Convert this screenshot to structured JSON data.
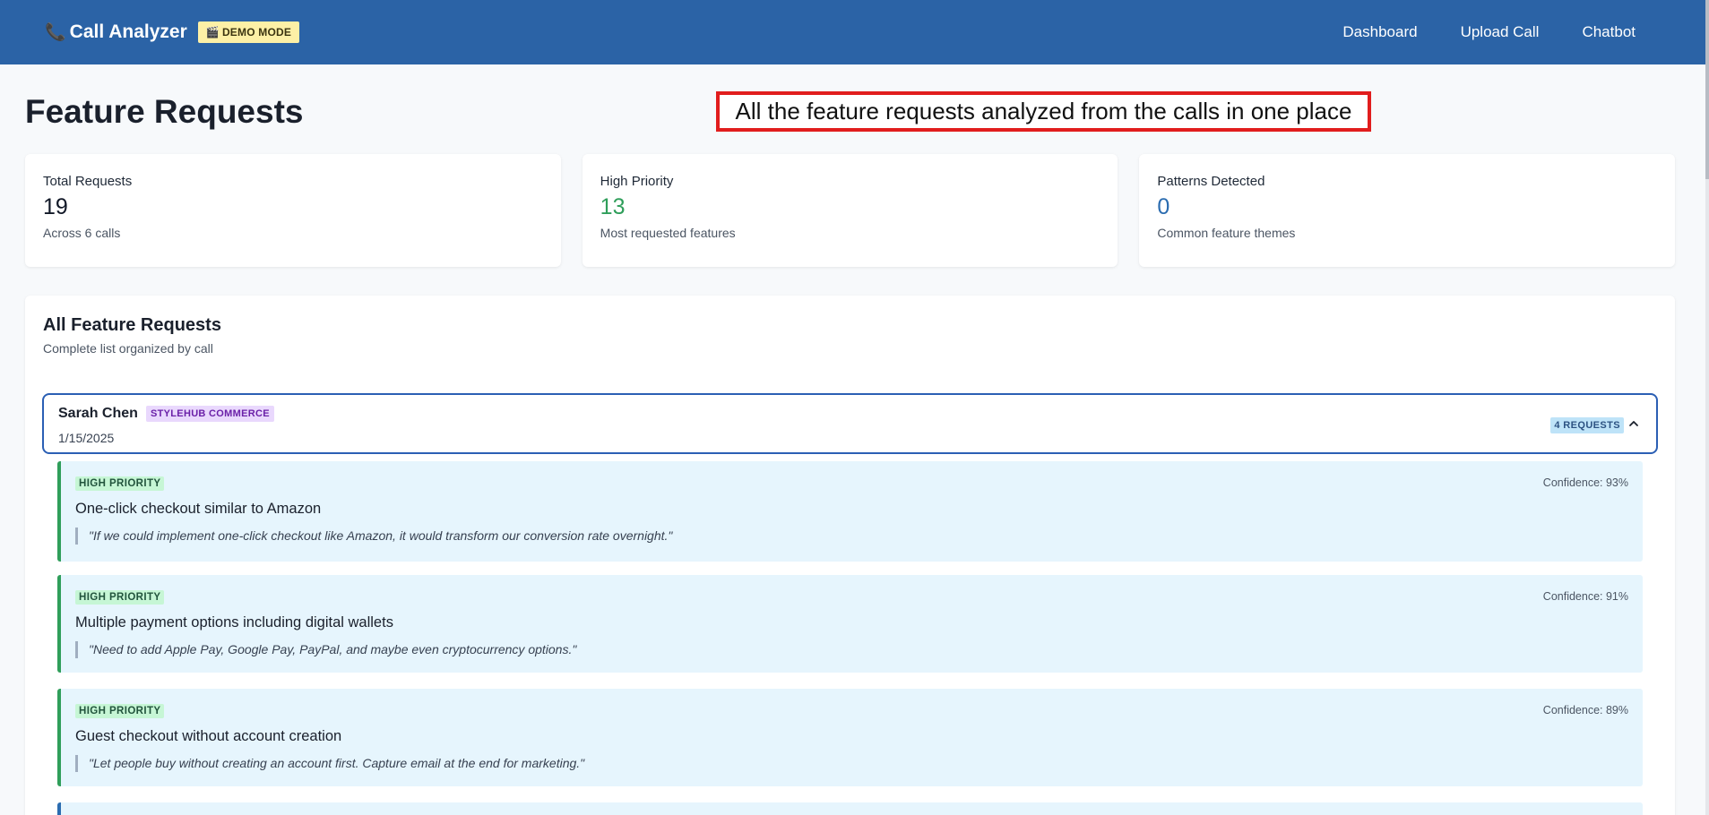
{
  "header": {
    "app_title": "Call Analyzer",
    "demo_badge": "DEMO MODE",
    "nav": [
      "Dashboard",
      "Upload Call",
      "Chatbot"
    ]
  },
  "page": {
    "title": "Feature Requests",
    "annotation": "All the feature requests analyzed from the calls in one place"
  },
  "stats": [
    {
      "label": "Total Requests",
      "value": "19",
      "sub": "Across 6 calls"
    },
    {
      "label": "High Priority",
      "value": "13",
      "sub": "Most requested features"
    },
    {
      "label": "Patterns Detected",
      "value": "0",
      "sub": "Common feature themes"
    }
  ],
  "panel": {
    "title": "All Feature Requests",
    "subtitle": "Complete list organized by call"
  },
  "call": {
    "name": "Sarah Chen",
    "company": "STYLEHUB COMMERCE",
    "date": "1/15/2025",
    "requests_badge": "4 REQUESTS"
  },
  "requests": [
    {
      "priority": "HIGH PRIORITY",
      "confidence": "Confidence: 93%",
      "title": "One-click checkout similar to Amazon",
      "quote": "\"If we could implement one-click checkout like Amazon, it would transform our conversion rate overnight.\""
    },
    {
      "priority": "HIGH PRIORITY",
      "confidence": "Confidence: 91%",
      "title": "Multiple payment options including digital wallets",
      "quote": "\"Need to add Apple Pay, Google Pay, PayPal, and maybe even cryptocurrency options.\""
    },
    {
      "priority": "HIGH PRIORITY",
      "confidence": "Confidence: 89%",
      "title": "Guest checkout without account creation",
      "quote": "\"Let people buy without creating an account first. Capture email at the end for marketing.\""
    }
  ],
  "colors": {
    "header_bg": "#2b63a6",
    "high_priority": "#2f9e5a",
    "accent_blue": "#2b6cb0",
    "annotation_border": "#e11d1d"
  }
}
